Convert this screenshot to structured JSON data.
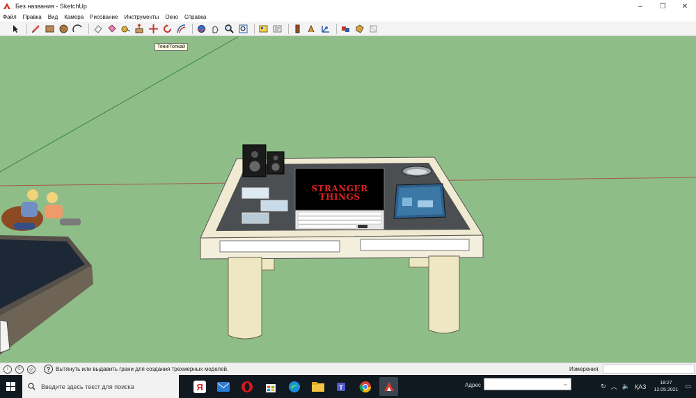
{
  "window": {
    "title": "Без названия - SketchUp",
    "controls": [
      "–",
      "❐",
      "✕"
    ]
  },
  "menu": [
    "Файл",
    "Правка",
    "Вид",
    "Камера",
    "Рисование",
    "Инструменты",
    "Окно",
    "Справка"
  ],
  "toolbar": {
    "tools": [
      "select-icon",
      "pencil-icon",
      "rectangle-icon",
      "circle-icon",
      "arc-icon",
      "eraser-icon",
      "paint-bucket-icon",
      "tape-measure-icon",
      "push-pull-icon",
      "move-icon",
      "rotate-icon",
      "offset-icon",
      "orbit-icon",
      "pan-icon",
      "zoom-icon",
      "zoom-extents-icon",
      "warehouse-icon",
      "extension-icon",
      "section-icon",
      "text-icon",
      "axes-icon",
      "dimension-icon",
      "components-icon",
      "materials-icon",
      "styles-icon"
    ],
    "tooltip": "Тяни/Толкай"
  },
  "viewport": {
    "screen_title_line1": "STRANGER",
    "screen_title_line2": "THINGS",
    "colors": {
      "sky": "#8fbd88",
      "table_frame": "#f0ead2",
      "table_top": "#4c4f52",
      "leg": "#eee7c4"
    }
  },
  "statusbar": {
    "message": "Вытянуть или выдавить грани для создания трехмерных моделей.",
    "measure_label": "Измерения",
    "measure_value": ""
  },
  "taskbar": {
    "search_placeholder": "Введите здесь текст для поиска",
    "address_label": "Адрес",
    "language": "ҚАЗ",
    "time": "18:27",
    "date": "12.05.2021"
  }
}
